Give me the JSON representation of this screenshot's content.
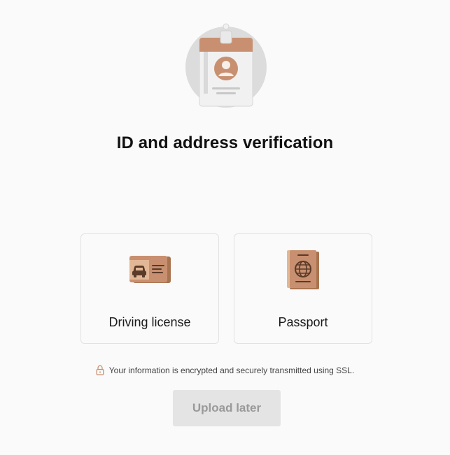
{
  "page": {
    "title": "ID and address verification"
  },
  "options": [
    {
      "label": "Driving license",
      "icon": "driving-license-icon"
    },
    {
      "label": "Passport",
      "icon": "passport-icon"
    }
  ],
  "security_note": {
    "icon": "lock-icon",
    "text": "Your information is encrypted and securely transmitted using SSL."
  },
  "actions": {
    "upload_later_label": "Upload later"
  },
  "colors": {
    "background": "#fafafa",
    "accent_tan": "#c89070",
    "accent_brown": "#a8744f",
    "button_disabled_bg": "#e4e4e4",
    "button_disabled_text": "#9a9a9a",
    "card_border": "#e2e2e2"
  }
}
